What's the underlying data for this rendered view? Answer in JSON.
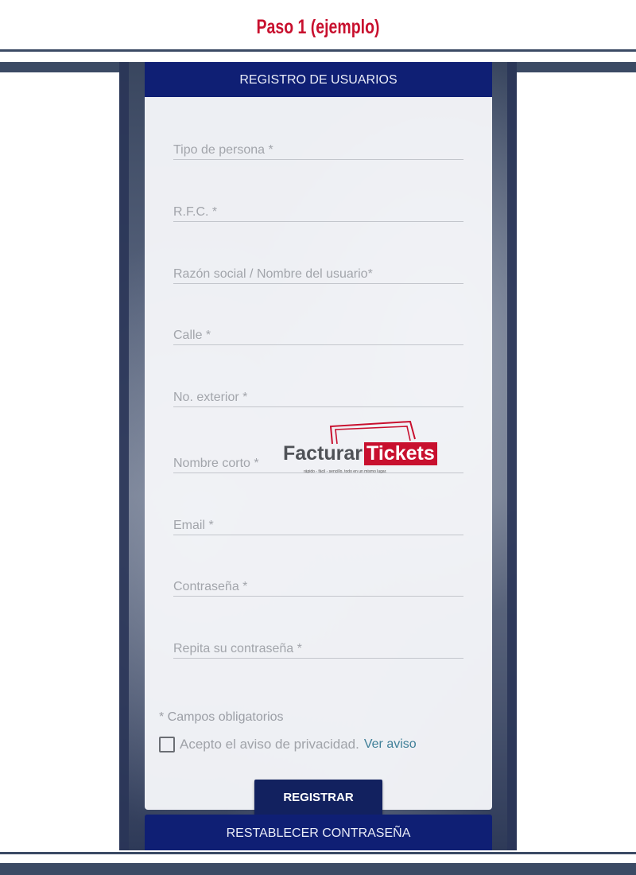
{
  "page_heading": "Paso 1 (ejemplo)",
  "colors": {
    "accent": "#c8102e",
    "navy": "#0f1f74",
    "button": "#12215f",
    "link": "#3f7f98"
  },
  "form": {
    "header": "REGISTRO DE USUARIOS",
    "fields": [
      {
        "placeholder": "Tipo de persona *",
        "value": ""
      },
      {
        "placeholder": "R.F.C. *",
        "value": ""
      },
      {
        "placeholder": "Razón social / Nombre del usuario*",
        "value": ""
      },
      {
        "placeholder": "Calle *",
        "value": ""
      },
      {
        "placeholder": "No. exterior *",
        "value": ""
      },
      {
        "placeholder": "Nombre corto *",
        "value": ""
      },
      {
        "placeholder": "Email *",
        "value": ""
      },
      {
        "placeholder": "Contraseña *",
        "value": ""
      },
      {
        "placeholder": "Repita su contraseña *",
        "value": ""
      }
    ],
    "required_note": "* Campos obligatorios",
    "privacy": {
      "checked": false,
      "label": "Acepto el aviso de privacidad.",
      "link": "Ver aviso"
    },
    "submit_label": "REGISTRAR",
    "reset_label": "RESTABLECER CONTRASEÑA"
  },
  "watermark": {
    "brand_main": "Facturar",
    "brand_box": "Tickets",
    "tagline": "rápido - fácil - sencillo, todo en un mismo lugar."
  }
}
